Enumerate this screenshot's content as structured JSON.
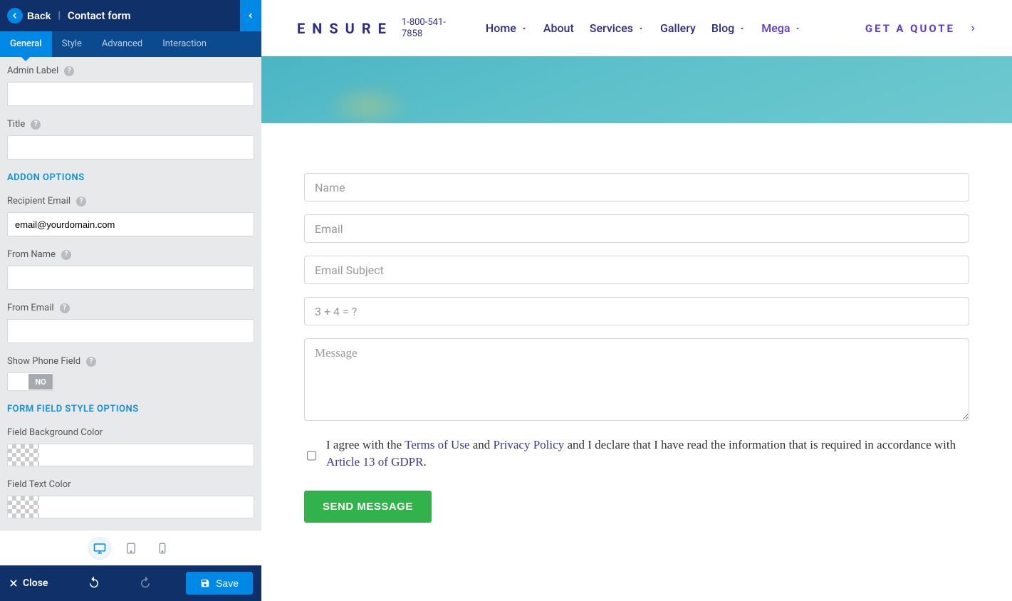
{
  "sidebar": {
    "back_label": "Back",
    "title": "Contact form",
    "tabs": [
      "General",
      "Style",
      "Advanced",
      "Interaction"
    ],
    "active_tab": 0,
    "fields": {
      "admin_label": {
        "label": "Admin Label",
        "value": ""
      },
      "title_field": {
        "label": "Title",
        "value": ""
      },
      "section_addon": "ADDON OPTIONS",
      "recipient_email": {
        "label": "Recipient Email",
        "value": "email@yourdomain.com"
      },
      "from_name": {
        "label": "From Name",
        "value": ""
      },
      "from_email": {
        "label": "From Email",
        "value": ""
      },
      "show_phone": {
        "label": "Show Phone Field",
        "value": "NO"
      },
      "section_style": "FORM FIELD STYLE OPTIONS",
      "bg_color": {
        "label": "Field Background Color"
      },
      "text_color": {
        "label": "Field Text Color"
      }
    },
    "footer": {
      "close": "Close",
      "save": "Save"
    }
  },
  "preview": {
    "logo": "ENSURE",
    "phone": "1-800-541-7858",
    "nav": [
      {
        "label": "Home",
        "dropdown": true,
        "purple": false
      },
      {
        "label": "About",
        "dropdown": false,
        "purple": false
      },
      {
        "label": "Services",
        "dropdown": true,
        "purple": false
      },
      {
        "label": "Gallery",
        "dropdown": false,
        "purple": false
      },
      {
        "label": "Blog",
        "dropdown": true,
        "purple": false
      },
      {
        "label": "Mega",
        "dropdown": true,
        "purple": true
      }
    ],
    "cta": "GET A QUOTE",
    "form": {
      "name_ph": "Name",
      "email_ph": "Email",
      "subject_ph": "Email Subject",
      "captcha_ph": "3 + 4 = ?",
      "message_ph": "Message",
      "consent_pre": "I agree with the ",
      "consent_terms": "Terms of Use",
      "consent_and": " and ",
      "consent_privacy": "Privacy Policy",
      "consent_mid": " and I declare that I have read the information that is required in accordance with ",
      "consent_gdpr": "Article 13 of GDPR",
      "consent_dot": ".",
      "send": "SEND MESSAGE"
    }
  }
}
